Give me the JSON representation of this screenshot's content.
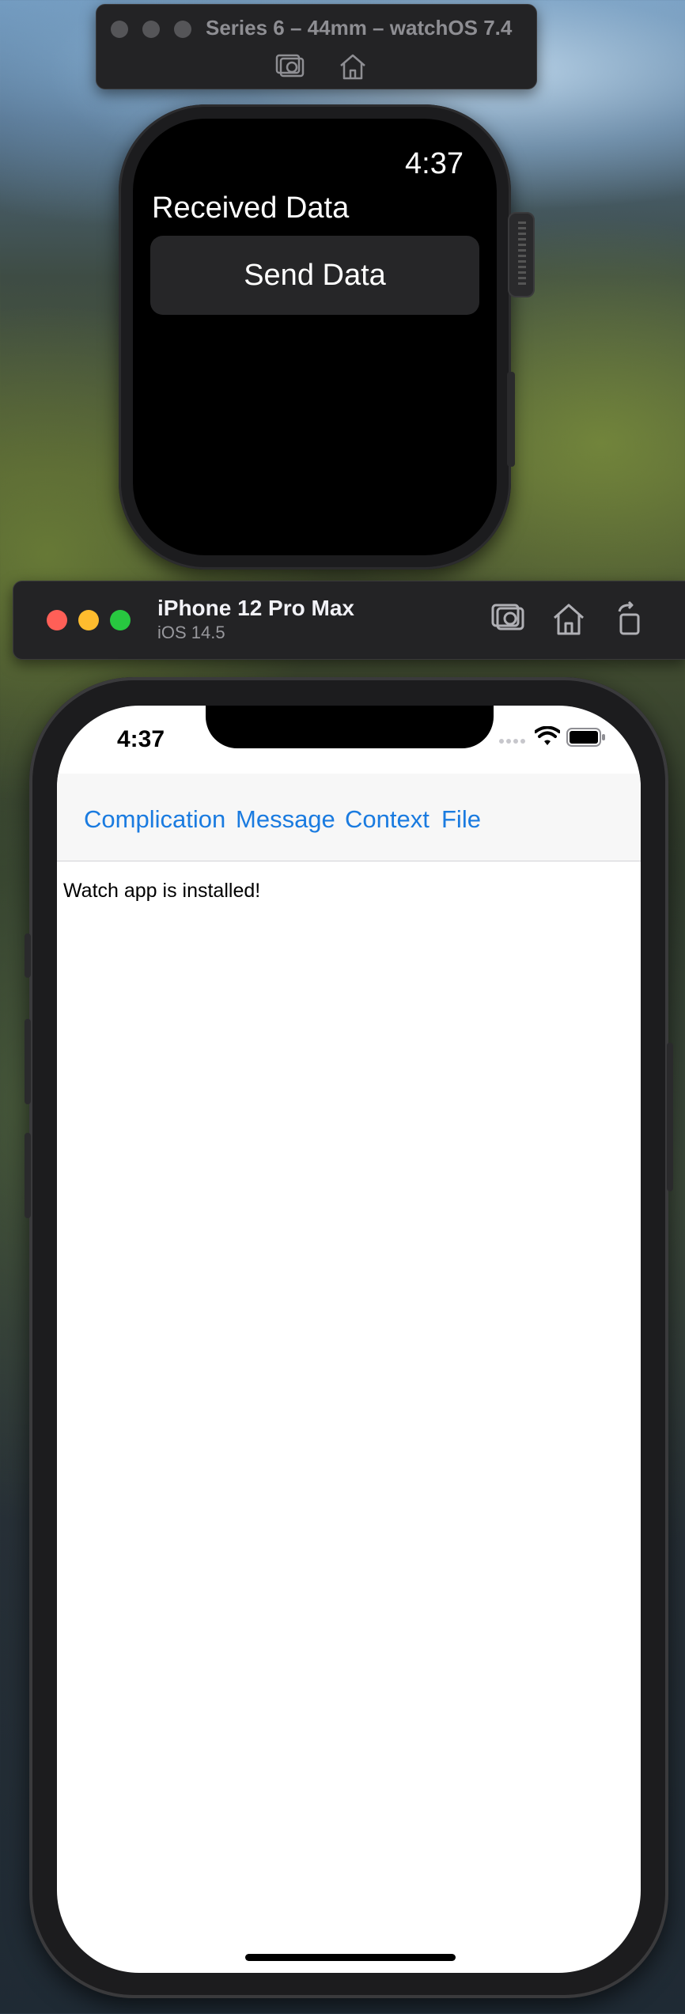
{
  "watch_window": {
    "title": "Series 6 – 44mm – watchOS 7.4",
    "toolbar": {
      "icons": [
        "screenshot-icon",
        "home-icon"
      ]
    }
  },
  "watch_screen": {
    "time": "4:37",
    "label": "Received Data",
    "button": "Send Data"
  },
  "iphone_window": {
    "title": "iPhone 12 Pro Max",
    "subtitle": "iOS 14.5",
    "toolbar": {
      "icons": [
        "screenshot-icon",
        "home-icon",
        "rotate-icon"
      ]
    }
  },
  "iphone_screen": {
    "time": "4:37",
    "tabs": [
      "Complication",
      "Message",
      "Context",
      "File"
    ],
    "status_text": "Watch app is installed!"
  },
  "colors": {
    "link_blue": "#1a7be0",
    "traffic_red": "#ff5f57",
    "traffic_yellow": "#febc2e",
    "traffic_green": "#28c840"
  }
}
